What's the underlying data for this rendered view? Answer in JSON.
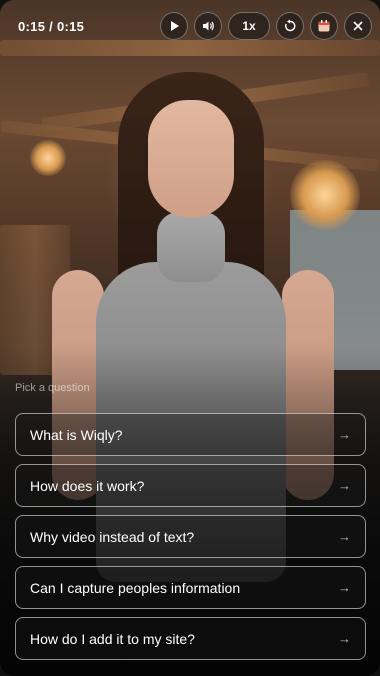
{
  "player": {
    "time": "0:15 / 0:15",
    "speed": "1x",
    "controls": [
      "play-icon",
      "volume-icon",
      "replay-icon",
      "calendar-icon",
      "close-icon"
    ]
  },
  "questions": {
    "prompt": "Pick a question",
    "items": [
      {
        "label": "What is Wiqly?"
      },
      {
        "label": "How does it work?"
      },
      {
        "label": "Why video instead of text?"
      },
      {
        "label": "Can I capture peoples information"
      },
      {
        "label": "How do I add it to my site?"
      }
    ]
  },
  "colors": {
    "accent": "#ffffff",
    "border": "#d8d8d8"
  }
}
